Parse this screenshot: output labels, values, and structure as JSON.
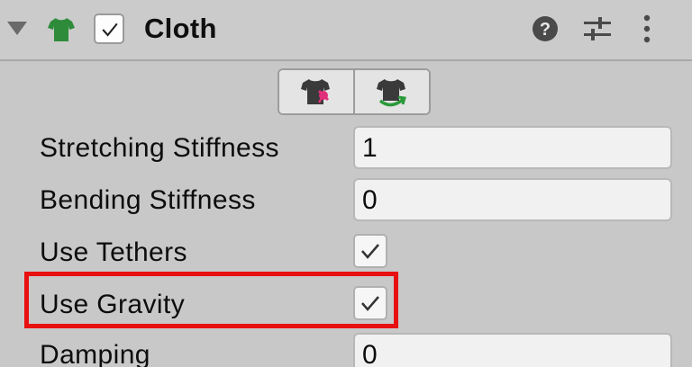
{
  "component": {
    "title": "Cloth",
    "enabled": true,
    "icon": "shirt-icon",
    "header_icons": [
      "help-icon",
      "preset-icon",
      "menu-icon"
    ]
  },
  "toolbar": {
    "buttons": [
      {
        "icon": "edit-constraints-icon"
      },
      {
        "icon": "edit-self-collision-icon"
      }
    ]
  },
  "properties": [
    {
      "label": "Stretching Stiffness",
      "type": "number",
      "value": "1"
    },
    {
      "label": "Bending Stiffness",
      "type": "number",
      "value": "0"
    },
    {
      "label": "Use Tethers",
      "type": "checkbox",
      "checked": true
    },
    {
      "label": "Use Gravity",
      "type": "checkbox",
      "checked": true,
      "highlighted": true
    },
    {
      "label": "Damping",
      "type": "number",
      "value": "0"
    }
  ],
  "colors": {
    "highlight": "#e81010",
    "shirt": "#2e8b3a",
    "pin": "#e0307a",
    "arrow": "#2a9a3a"
  }
}
